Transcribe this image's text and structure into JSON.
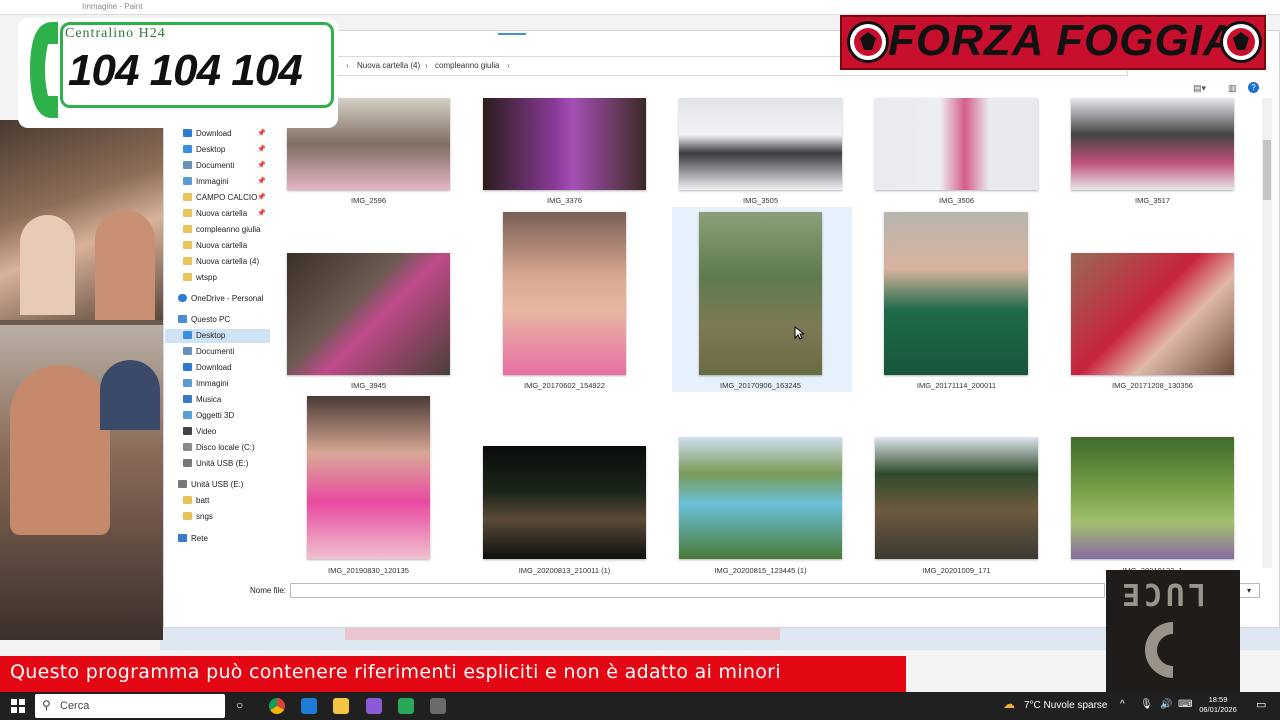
{
  "paint": {
    "title": "Immagine - Paint"
  },
  "breadcrumb": [
    "Nuova cartella (4)",
    "compleanno giulia"
  ],
  "sidebar": {
    "quick_access": [
      {
        "label": "Download",
        "pinned": true
      },
      {
        "label": "Desktop",
        "pinned": true
      },
      {
        "label": "Documenti",
        "pinned": true
      },
      {
        "label": "Immagini",
        "pinned": true
      },
      {
        "label": "CAMPO CALCIO",
        "pinned": true
      },
      {
        "label": "Nuova cartella",
        "pinned": true
      },
      {
        "label": "compleanno giulia",
        "pinned": false
      },
      {
        "label": "Nuova cartella",
        "pinned": false
      },
      {
        "label": "Nuova cartella (4)",
        "pinned": false
      },
      {
        "label": "wtspp",
        "pinned": false
      }
    ],
    "onedrive": "OneDrive - Personal",
    "this_pc": "Questo PC",
    "pc_items": [
      "Desktop",
      "Documenti",
      "Download",
      "Immagini",
      "Musica",
      "Oggetti 3D",
      "Video",
      "Disco locale (C:)",
      "Unità USB (E:)"
    ],
    "usb": "Unità USB (E:)",
    "usb_items": [
      "batt",
      "sngs"
    ],
    "network": "Rete"
  },
  "files": [
    "IMG_2596",
    "IMG_3376",
    "IMG_3505",
    "IMG_3506",
    "IMG_3517",
    "IMG_3945",
    "IMG_20170602_154922",
    "IMG_20170906_163245",
    "IMG_20171114_200011",
    "IMG_20171208_130356",
    "IMG_20190830_120135",
    "IMG_20200813_210011 (1)",
    "IMG_20200815_123445 (1)",
    "IMG_20201009_171",
    "IMG_20210123_1"
  ],
  "footer": {
    "filename_label": "Nome file:",
    "filename_value": ""
  },
  "overlay": {
    "centralino_title": "Centralino H24",
    "centralino_number": "104 104 104",
    "team": "FORZA FOGGIA",
    "warning": "Questo programma  può contenere riferimenti espliciti e non è adatto ai minori",
    "channel": "LUCE"
  },
  "taskbar": {
    "search_label": "Cerca",
    "weather": "7°C  Nuvole sparse",
    "time": "18:59",
    "date": "06/01/2026"
  },
  "colors": {
    "warning_red": "#e30613",
    "forza_red": "#c8102e",
    "centralino_green": "#2eb04a"
  }
}
